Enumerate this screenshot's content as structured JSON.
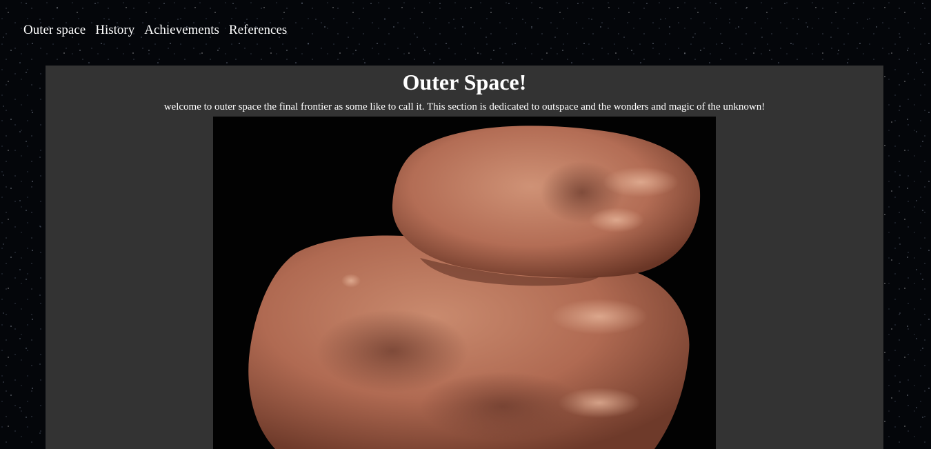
{
  "nav": {
    "items": [
      {
        "label": "Outer space"
      },
      {
        "label": "History"
      },
      {
        "label": "Achievements"
      },
      {
        "label": "References"
      }
    ]
  },
  "main": {
    "title": "Outer Space!",
    "intro": "welcome to outer space the final frontier as some like to call it. This section is dedicated to outspace and the wonders and magic of the unknown!"
  },
  "colors": {
    "panel_background": "#333333",
    "text": "#ffffff",
    "page_background": "#04060a",
    "object_base": "#b06a52"
  }
}
